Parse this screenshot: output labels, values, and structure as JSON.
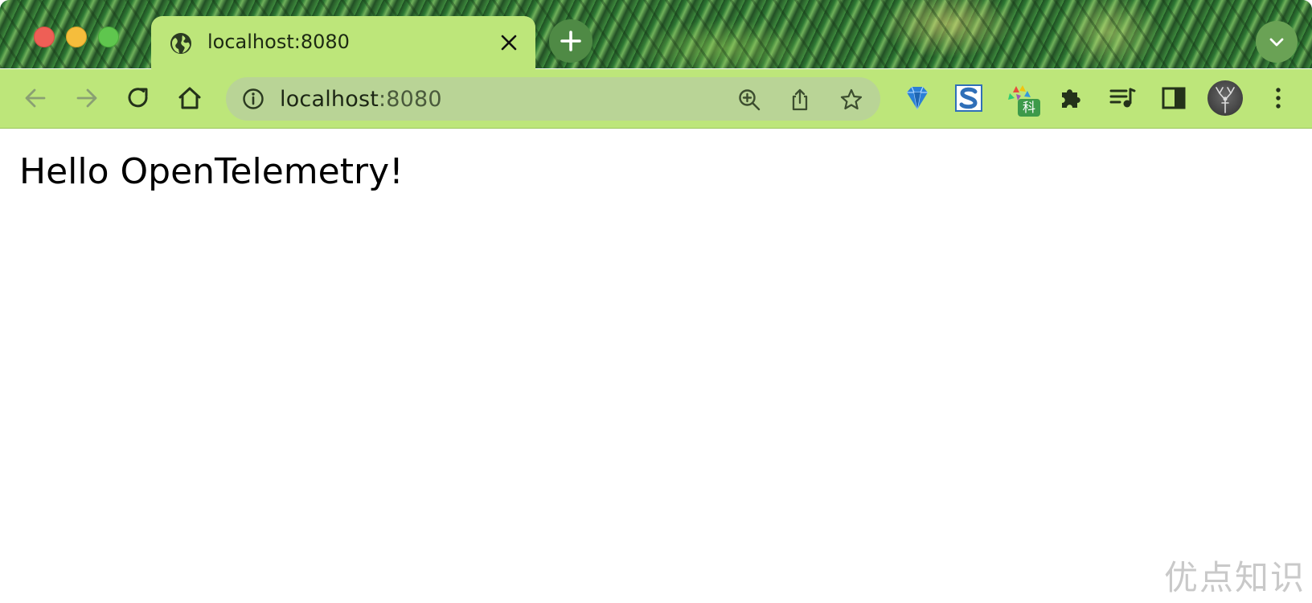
{
  "window": {
    "traffic_lights": [
      "close",
      "minimize",
      "zoom"
    ]
  },
  "tab": {
    "title": "localhost:8080",
    "favicon": "globe-icon",
    "close_icon": "close-icon"
  },
  "toolbar": {
    "url_host": "localhost",
    "url_port": ":8080",
    "icons": [
      "back-arrow-icon",
      "forward-arrow-icon",
      "reload-icon",
      "home-icon",
      "info-icon",
      "zoom-in-icon",
      "share-icon",
      "bookmark-star-icon"
    ],
    "extensions": [
      "diamond-extension-icon",
      "s-extension-icon",
      "colorful-extension-icon",
      "puzzle-extensions-icon",
      "media-playlist-icon",
      "side-panel-icon"
    ],
    "extension_badge": "科"
  },
  "page": {
    "heading": "Hello OpenTelemetry!"
  },
  "watermark": "优点知识",
  "colors": {
    "tab_bg": "#bde67a",
    "omnibox_bg": "#b9d496",
    "close": "#ee5f56",
    "minimize": "#f5bd3c",
    "zoom": "#5fc64e"
  }
}
